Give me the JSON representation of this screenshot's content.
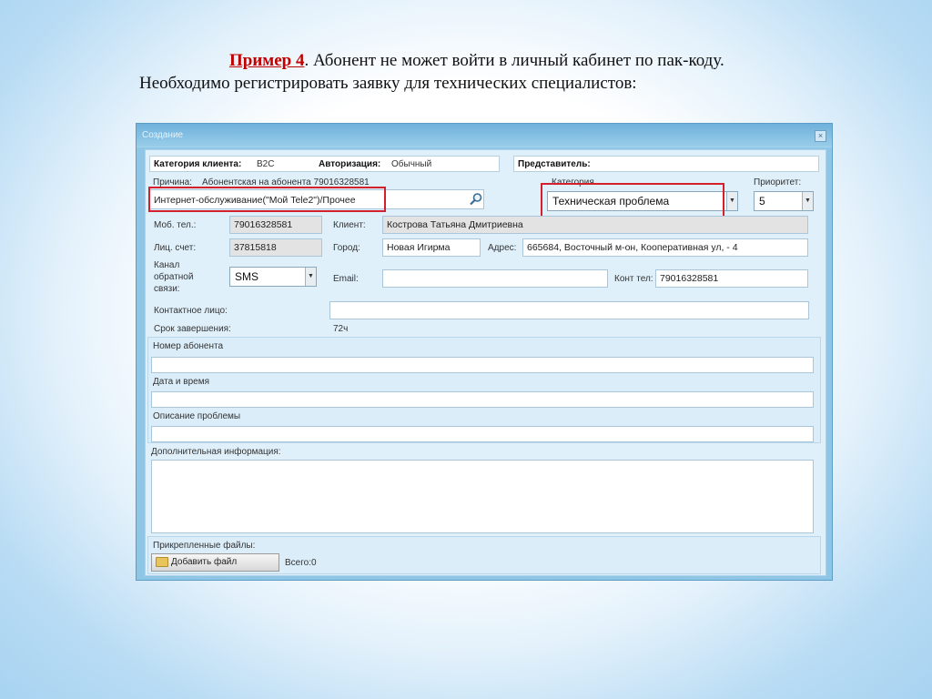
{
  "slide": {
    "example_label": "Пример 4",
    "heading_rest": ".  Абонент не может войти в личный кабинет по пак-коду.",
    "line2": "Необходимо регистрировать заявку для технических специалистов:"
  },
  "window": {
    "title": "Создание",
    "close_icon": "×"
  },
  "header": {
    "client_category_label": "Категория клиента:",
    "client_category_value": "B2C",
    "authorization_label": "Авторизация:",
    "authorization_value": "Обычный",
    "representative_label": "Представитель:"
  },
  "reason": {
    "label": "Причина:",
    "text": "Абонентская    на абонента 79016328581",
    "value": "Интернет-обслуживание(\"Мой Tele2\")/Прочее"
  },
  "category": {
    "label": "Категория",
    "value": "Техническая проблема"
  },
  "priority": {
    "label": "Приоритет:",
    "value": "5"
  },
  "fields": {
    "mobile_label": "Моб. тел.:",
    "mobile_value": "79016328581",
    "client_label": "Клиент:",
    "client_value": "Кострова Татьяна Дмитриевна",
    "account_label": "Лиц. счет:",
    "account_value": "37815818",
    "city_label": "Город:",
    "city_value": "Новая Игирма",
    "address_label": "Адрес:",
    "address_value": "665684, Восточный м-он, Кооперативная ул, -  4",
    "channel_label_1": "Канал",
    "channel_label_2": "обратной",
    "channel_label_3": "связи:",
    "channel_value": "SMS",
    "email_label": "Email:",
    "email_value": "",
    "contact_phone_label": "Конт тел:",
    "contact_phone_value": "79016328581",
    "contact_person_label": "Контактное лицо:",
    "contact_person_value": "",
    "deadline_label": "Срок завершения:",
    "deadline_value": "72ч"
  },
  "sections": {
    "subscriber_number_label": "Номер абонента",
    "subscriber_number_value": "",
    "datetime_label": "Дата и время",
    "datetime_value": "",
    "problem_label": "Описание проблемы",
    "problem_value": "",
    "additional_label": "Дополнительная информация:",
    "additional_value": ""
  },
  "attachments": {
    "label": "Прикрепленные файлы:",
    "add_button": "Добавить файл",
    "total": "Всего:0"
  },
  "colors": {
    "highlight": "#d4202c",
    "example_label": "#c00000"
  }
}
